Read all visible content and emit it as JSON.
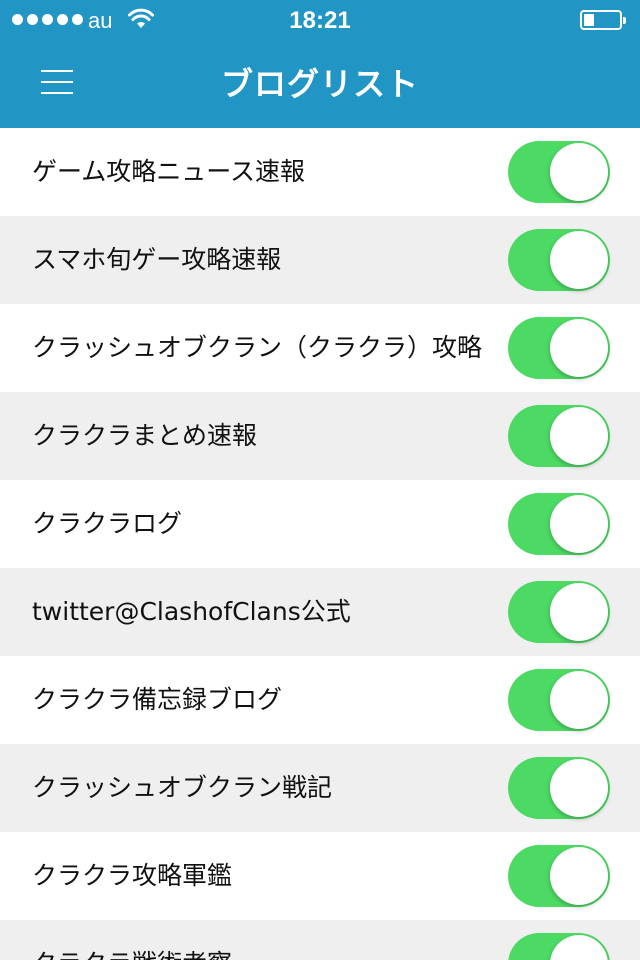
{
  "status_bar": {
    "carrier": "au",
    "time": "18:21",
    "signal_bars": 5,
    "battery_level": 0.3
  },
  "nav": {
    "title": "ブログリスト",
    "menu_icon": "hamburger-menu-icon"
  },
  "colors": {
    "header_bg": "#2196c4",
    "toggle_on": "#4cd964",
    "row_alt_bg": "#efefef"
  },
  "blogs": [
    {
      "label": "ゲーム攻略ニュース速報",
      "enabled": true
    },
    {
      "label": "スマホ旬ゲー攻略速報",
      "enabled": true
    },
    {
      "label": "クラッシュオブクラン（クラクラ）攻略",
      "enabled": true
    },
    {
      "label": "クラクラまとめ速報",
      "enabled": true
    },
    {
      "label": "クラクラログ",
      "enabled": true
    },
    {
      "label": "twitter@ClashofClans公式",
      "enabled": true
    },
    {
      "label": "クラクラ備忘録ブログ",
      "enabled": true
    },
    {
      "label": "クラッシュオブクラン戦記",
      "enabled": true
    },
    {
      "label": "クラクラ攻略軍鑑",
      "enabled": true
    },
    {
      "label": "クラクラ戦術考察",
      "enabled": true
    }
  ]
}
